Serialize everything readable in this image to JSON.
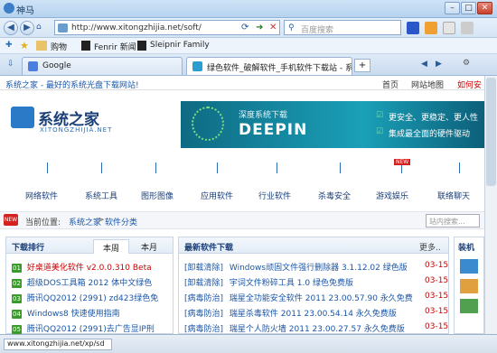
{
  "window": {
    "title": "神马",
    "minimize": "–",
    "maximize": "□",
    "close": "✕"
  },
  "nav": {
    "back": "◀",
    "forward": "▶",
    "url": "http://www.xitongzhijia.net/soft/",
    "search_placeholder": "百度搜索"
  },
  "favorites": [
    {
      "label": "购物"
    },
    {
      "label": "Fenrir 新闻"
    },
    {
      "label": "Sleipnir Family"
    }
  ],
  "tabs": [
    {
      "label": "Google",
      "active": false
    },
    {
      "label": "绿色软件_破解软件_手机软件下载站 - 系...",
      "active": true
    }
  ],
  "page": {
    "header_left": "系统之家 - 最好的系统光盘下载网站!",
    "header_right": [
      "首页",
      "网站地图",
      "如何安"
    ],
    "logo_main": "系统之家",
    "logo_sub": "XITONGZHIJIA.NET",
    "banner": {
      "title": "深度系统下载",
      "brand": "DEEPIN",
      "points": [
        "更安全、更稳定、更人性",
        "集成最全面的硬件驱动"
      ]
    },
    "nav_items": [
      "网络软件",
      "系统工具",
      "图形图像",
      "应用软件",
      "行业软件",
      "杀毒安全",
      "游戏娱乐",
      "联络聊天"
    ],
    "new_badge": "NEW",
    "breadcrumb_prefix": "当前位置:",
    "breadcrumb": [
      "系统之家",
      "软件分类"
    ],
    "search_placeholder": "站内搜索...",
    "ranking": {
      "title": "下载排行",
      "tabs": [
        "本周",
        "本月"
      ],
      "items": [
        {
          "num": "01",
          "text": "好桌道美化软件 v2.0.0.310 Beta",
          "hot": true
        },
        {
          "num": "02",
          "text": "超级DOS工具箱 2012 体中文绿色",
          "hot": false
        },
        {
          "num": "03",
          "text": "腾讯QQ2012 (2991) zd423绿色免",
          "hot": false
        },
        {
          "num": "04",
          "text": "Windows8 快速使用指南",
          "hot": false
        },
        {
          "num": "05",
          "text": "腾讯QQ2012 (2991)去广告显IP刑",
          "hot": false
        }
      ]
    },
    "latest": {
      "title": "最新软件下载",
      "more": "更多..",
      "items": [
        {
          "cat": "[卸载清除]",
          "text": "Windows顽固文件强行删除器 3.1.12.02 绿色版",
          "date": "03-15"
        },
        {
          "cat": "[卸载清除]",
          "text": "宇词文件粉碎工具 1.0 绿色免费版",
          "date": "03-15"
        },
        {
          "cat": "[病毒防治]",
          "text": "瑞星全功能安全软件 2011 23.00.57.90 永久免费",
          "date": "03-15"
        },
        {
          "cat": "[病毒防治]",
          "text": "瑞星杀毒软件 2011 23.00.54.14 永久免费版",
          "date": "03-15"
        },
        {
          "cat": "[病毒防治]",
          "text": "瑞星个人防火墙 2011 23.00.27.57 永久免费版",
          "date": "03-15"
        }
      ]
    },
    "side_title": "装机"
  },
  "status": {
    "url": "www.xitongzhijia.net/xp/sd"
  },
  "colors": {
    "accent": "#1a56a7",
    "hot": "#cc0000",
    "banner": "#1aa0b8"
  }
}
